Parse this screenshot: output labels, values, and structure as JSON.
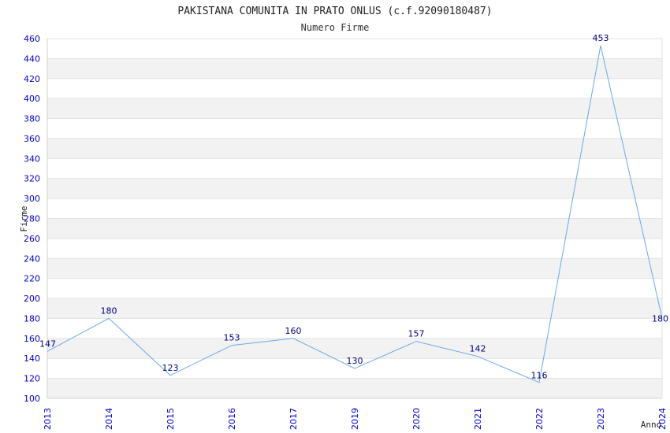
{
  "chart_data": {
    "type": "line",
    "title": "PAKISTANA COMUNITA IN PRATO ONLUS (c.f.92090180487)",
    "subtitle": "Numero Firme",
    "xlabel": "Anno",
    "ylabel": "Firme",
    "categories": [
      "2013",
      "2014",
      "2015",
      "2016",
      "2017",
      "2019",
      "2020",
      "2021",
      "2022",
      "2023",
      "2024"
    ],
    "values": [
      147,
      180,
      123,
      153,
      160,
      130,
      157,
      142,
      116,
      453,
      180
    ],
    "ylim": [
      100,
      460
    ],
    "yticks": [
      "100",
      "120",
      "140",
      "160",
      "180",
      "200",
      "220",
      "240",
      "260",
      "280",
      "300",
      "320",
      "340",
      "360",
      "380",
      "400",
      "420",
      "440",
      "460"
    ],
    "grid": true,
    "colors": {
      "line": "#6aa9e9",
      "band": "#f2f2f2",
      "tick_text": "#0000cc",
      "data_label": "#000080"
    }
  }
}
